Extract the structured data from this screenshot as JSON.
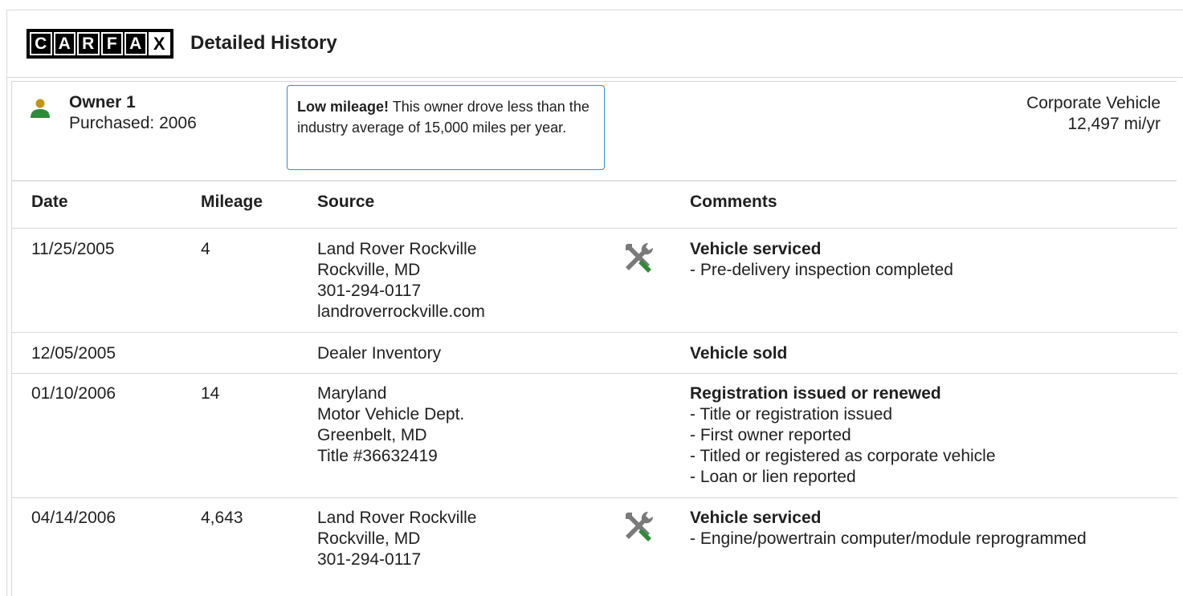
{
  "header": {
    "logo_letters": [
      "C",
      "A",
      "R",
      "F",
      "A",
      "X"
    ],
    "title": "Detailed History"
  },
  "owner": {
    "name": "Owner 1",
    "purchased": "Purchased: 2006",
    "callout_bold": "Low mileage!",
    "callout_text": " This owner drove less than the industry average of 15,000 miles per year.",
    "type": "Corporate Vehicle",
    "mileage_rate": "12,497 mi/yr",
    "icon": "person-icon",
    "icon_colors": {
      "head": "#c69214",
      "body": "#2e8b3a"
    }
  },
  "table": {
    "columns": [
      "Date",
      "Mileage",
      "Source",
      "Comments"
    ],
    "rows": [
      {
        "date": "11/25/2005",
        "mileage": "4",
        "source": [
          "Land Rover Rockville",
          "Rockville, MD",
          "301-294-0117",
          "landroverrockville.com"
        ],
        "icon": "service-tools-icon",
        "comment_title": "Vehicle serviced",
        "comments": [
          "- Pre-delivery inspection completed"
        ]
      },
      {
        "date": "12/05/2005",
        "mileage": "",
        "source": [
          "Dealer Inventory"
        ],
        "icon": "",
        "comment_title": "Vehicle sold",
        "comments": []
      },
      {
        "date": "01/10/2006",
        "mileage": "14",
        "source": [
          "Maryland",
          "Motor Vehicle Dept.",
          "Greenbelt, MD",
          "Title #36632419"
        ],
        "icon": "",
        "comment_title": "Registration issued or renewed",
        "comments": [
          "- Title or registration issued",
          "- First owner reported",
          "- Titled or registered as corporate vehicle",
          "- Loan or lien reported"
        ]
      },
      {
        "date": "04/14/2006",
        "mileage": "4,643",
        "source": [
          "Land Rover Rockville",
          "Rockville, MD",
          "301-294-0117"
        ],
        "icon": "service-tools-icon",
        "comment_title": "Vehicle serviced",
        "comments": [
          "- Engine/powertrain computer/module reprogrammed"
        ]
      }
    ]
  },
  "colors": {
    "callout_border": "#3a8bd0",
    "wrench_gray": "#7a7a7a",
    "screwdriver_green": "#2e8b3a"
  }
}
